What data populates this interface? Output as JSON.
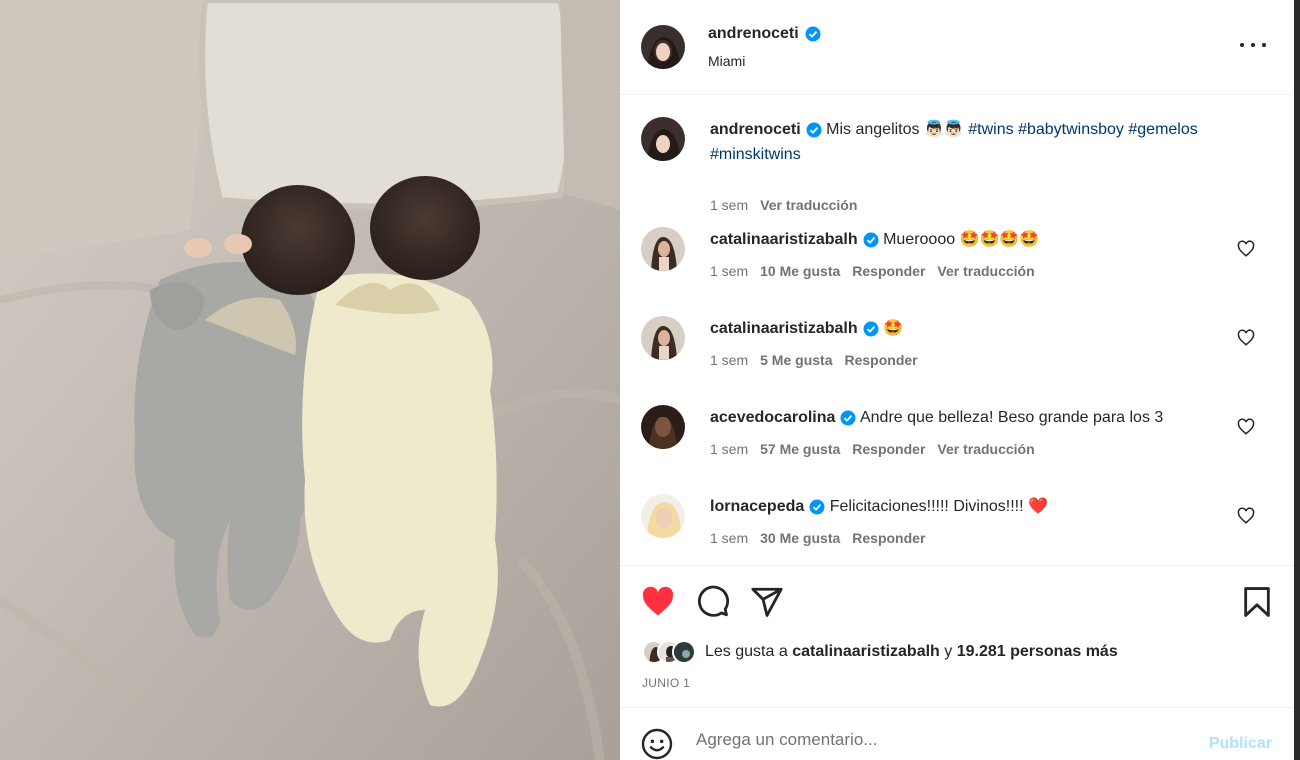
{
  "post": {
    "username": "andrenoceti",
    "location": "Miami",
    "photo_alt": "twin babies lying face down in angel-wing onesies"
  },
  "caption": {
    "username": "andrenoceti",
    "text": "Mis angelitos 👼🏻👼🏻",
    "hashtags": [
      "#twins",
      "#babytwinsboy",
      "#gemelos",
      "#minskitwins"
    ],
    "time": "1 sem",
    "translate": "Ver traducción"
  },
  "comments": [
    {
      "username": "catalinaaristizabalh",
      "text": "Mueroooo 🤩🤩🤩🤩",
      "time": "1 sem",
      "likes": "10 Me gusta",
      "reply": "Responder",
      "translate": "Ver traducción"
    },
    {
      "username": "catalinaaristizabalh",
      "text": "🤩",
      "time": "1 sem",
      "likes": "5 Me gusta",
      "reply": "Responder",
      "translate": ""
    },
    {
      "username": "acevedocarolina",
      "text": "Andre que belleza! Beso grande para los 3",
      "time": "1 sem",
      "likes": "57 Me gusta",
      "reply": "Responder",
      "translate": "Ver traducción"
    },
    {
      "username": "lornacepeda",
      "text": "Felicitaciones!!!!! Divinos!!!! ❤️",
      "time": "1 sem",
      "likes": "30 Me gusta",
      "reply": "Responder",
      "translate": ""
    }
  ],
  "likes": {
    "prefix": "Les gusta a",
    "user": "catalinaaristizabalh",
    "joiner": "y",
    "others": "19.281 personas más"
  },
  "date": "JUNIO 1",
  "composer": {
    "placeholder": "Agrega un comentario...",
    "publish_label": "Publicar"
  },
  "colors": {
    "liked_heart": "#ff3040",
    "verified": "#0095f6",
    "hashtag": "#00376b",
    "publish_disabled": "#b2dffc"
  },
  "icons": [
    "heart-icon",
    "comment-icon",
    "share-icon",
    "bookmark-icon",
    "more-icon",
    "verified-icon",
    "emoji-icon"
  ]
}
